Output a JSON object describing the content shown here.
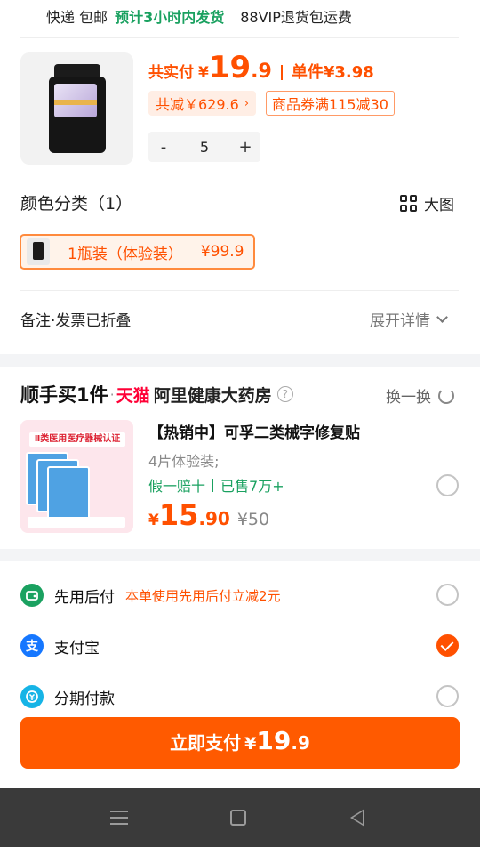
{
  "shipping": {
    "label": "快递 包邮",
    "dispatch": "预计3小时内发货",
    "vip": "88VIP退货包运费"
  },
  "product": {
    "actual_label": "共实付",
    "currency": "¥",
    "price_int": "19",
    "price_dec": ".9",
    "unit_price": "单件¥3.98",
    "discount": "共减￥629.6",
    "coupon": "商品券满115减30",
    "qty_minus": "-",
    "quantity": "5",
    "qty_plus": "+"
  },
  "variant": {
    "title": "颜色分类（1）",
    "big_pic": "大图",
    "selected_name": "1瓶装（体验装）",
    "selected_price": "¥99.9"
  },
  "remark": {
    "label": "备注·发票已折叠",
    "expand": "展开详情"
  },
  "bundle": {
    "title": "顺手买1件",
    "tmall": "天猫",
    "store": "阿里健康大药房",
    "help": "?",
    "swap": "换一换",
    "item": {
      "title": "【热销中】可孚二类械字修复贴",
      "spec": "4片体验装;",
      "guarantee": "假一赔十",
      "sold": "已售7万+",
      "currency": "¥",
      "price_int": "15",
      "price_dec": ".90",
      "original": "¥50",
      "image_band": "Ⅱ类医用医疗器械认证"
    }
  },
  "payment": {
    "options": [
      {
        "name": "先用后付",
        "promo": "本单使用先用后付立减2元",
        "icon": "wallet-icon",
        "color": "#1aa160",
        "selected": false
      },
      {
        "name": "支付宝",
        "promo": "",
        "icon": "alipay-icon",
        "color": "#1677ff",
        "selected": true
      },
      {
        "name": "分期付款",
        "promo": "",
        "icon": "installment-icon",
        "color": "#16b4e6",
        "selected": false
      }
    ],
    "button_label": "立即支付",
    "currency": "¥",
    "price_int": "19",
    "price_dec": ".9"
  },
  "colors": {
    "accent": "#ff5000",
    "green": "#1aa160",
    "tmall": "#ff0036"
  }
}
